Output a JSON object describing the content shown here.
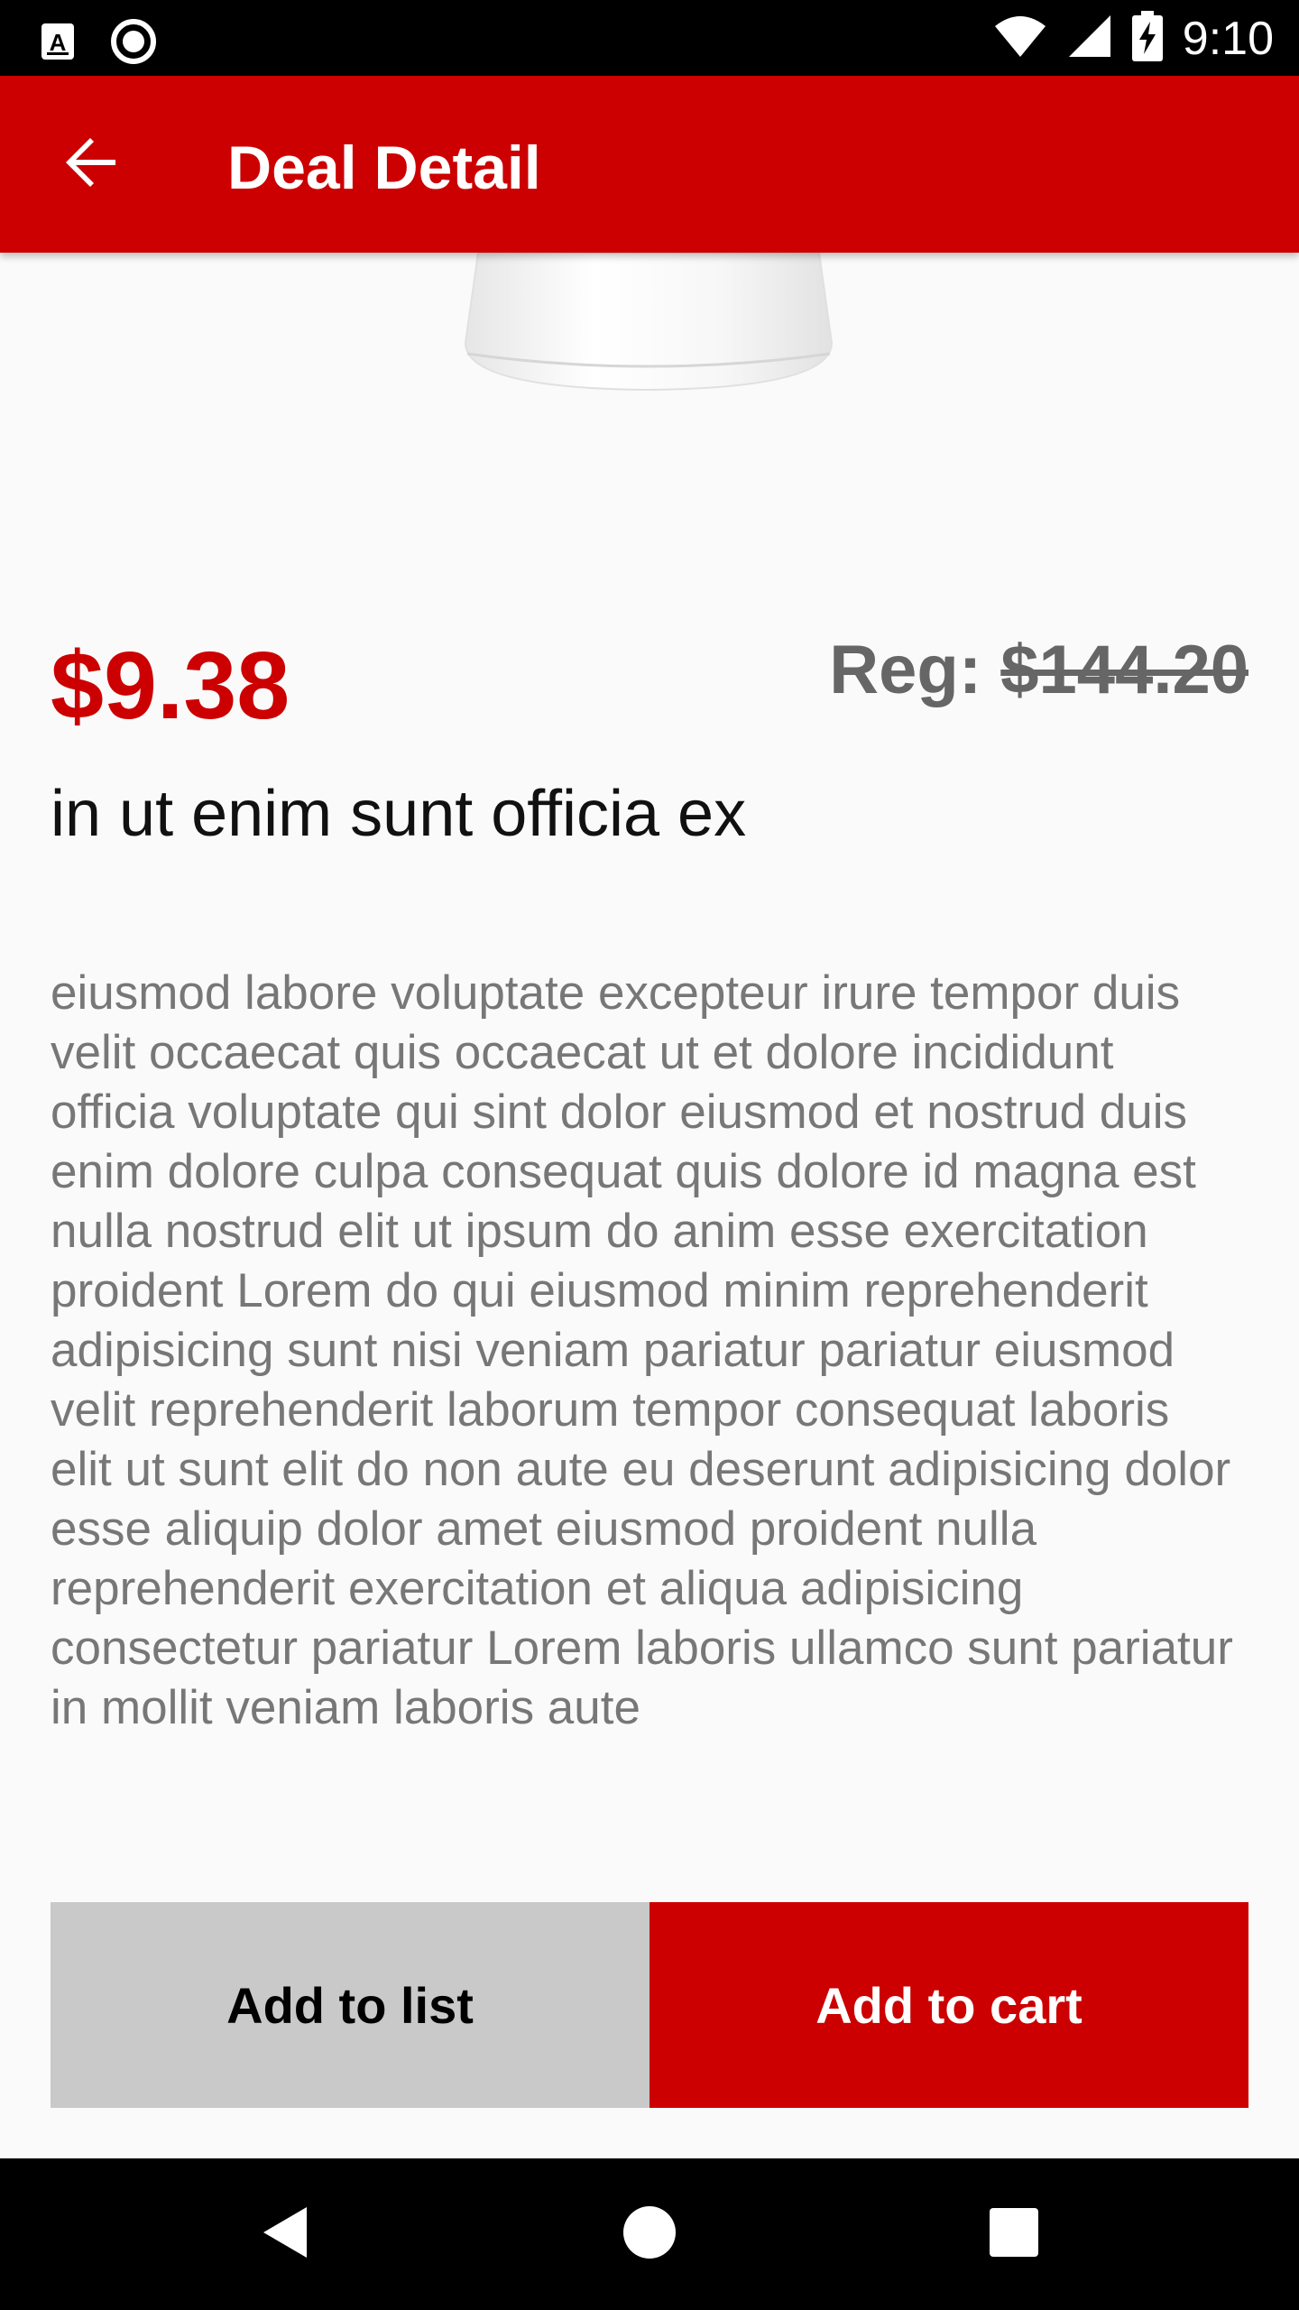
{
  "status_bar": {
    "time": "9:10",
    "icons": [
      "a-notification-icon",
      "record-icon",
      "wifi-icon",
      "signal-icon",
      "battery-charging-icon"
    ]
  },
  "app_bar": {
    "title": "Deal Detail",
    "back_icon": "arrow-back-icon",
    "color": "#cc0000"
  },
  "product": {
    "sale_price": "$9.38",
    "regular_label": "Reg: ",
    "regular_price": "$144.20",
    "title": "in ut enim sunt officia ex",
    "description": "eiusmod labore voluptate excepteur irure tempor duis velit occaecat quis occaecat ut et dolore incididunt officia voluptate qui sint dolor eiusmod et nostrud duis enim dolore culpa consequat quis dolore id magna est nulla nostrud elit ut ipsum do anim esse exercitation proident Lorem do qui eiusmod minim reprehenderit adipisicing sunt nisi veniam pariatur pariatur eiusmod velit reprehenderit laborum tempor consequat laboris elit ut sunt elit do non aute eu deserunt adipisicing dolor esse aliquip dolor amet eiusmod proident nulla reprehenderit exercitation et aliqua adipisicing consectetur pariatur Lorem laboris ullamco sunt pariatur in mollit veniam laboris aute"
  },
  "actions": {
    "add_to_list": "Add to list",
    "add_to_cart": "Add to cart"
  },
  "nav_bar": {
    "icons": [
      "back-triangle-icon",
      "home-circle-icon",
      "recents-square-icon"
    ]
  }
}
